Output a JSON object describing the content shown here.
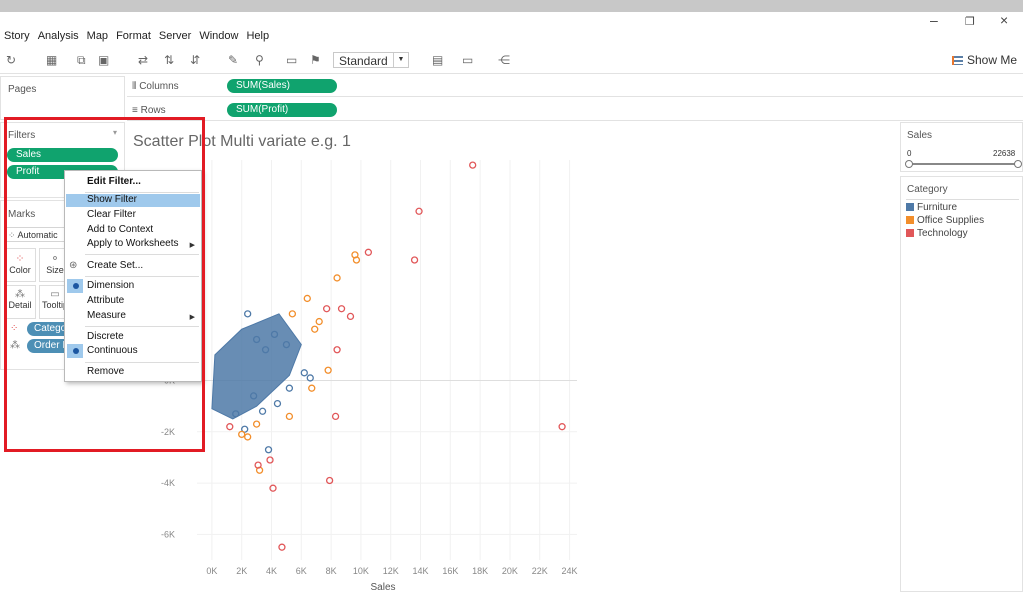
{
  "menubar": [
    "Story",
    "Analysis",
    "Map",
    "Format",
    "Server",
    "Window",
    "Help"
  ],
  "toolbar": {
    "mode": "Standard",
    "show_me": "Show Me"
  },
  "pages": {
    "title": "Pages"
  },
  "shelves": {
    "columns_label": "Columns",
    "columns_pill": "SUM(Sales)",
    "rows_label": "Rows",
    "rows_pill": "SUM(Profit)"
  },
  "filters": {
    "title": "Filters",
    "pills": [
      "Sales",
      "Profit"
    ]
  },
  "marks": {
    "title": "Marks",
    "type": "Automatic",
    "buttons": [
      "Color",
      "Size",
      "Detail",
      "Tooltip"
    ],
    "pills": [
      "Category",
      "Order ID"
    ]
  },
  "context_menu": {
    "items": [
      "Edit Filter...",
      "Show Filter",
      "Clear Filter",
      "Add to Context",
      "Apply to Worksheets",
      "Create Set...",
      "Dimension",
      "Attribute",
      "Measure",
      "Discrete",
      "Continuous",
      "Remove"
    ],
    "highlighted": "Show Filter",
    "checked": [
      "Dimension",
      "Continuous"
    ]
  },
  "sales_filter": {
    "title": "Sales",
    "min": "0",
    "max": "22638"
  },
  "legend": {
    "title": "Category",
    "items": [
      {
        "name": "Furniture",
        "color": "#4e79a7"
      },
      {
        "name": "Office Supplies",
        "color": "#f28e2b"
      },
      {
        "name": "Technology",
        "color": "#e15759"
      }
    ]
  },
  "chart_data": {
    "type": "scatter",
    "title": "Scatter Plot Multi variate e.g. 1",
    "xlabel": "Sales",
    "ylabel": "Profit",
    "x_ticks": [
      "0K",
      "2K",
      "4K",
      "6K",
      "8K",
      "10K",
      "12K",
      "14K",
      "16K",
      "18K",
      "20K",
      "22K",
      "24K"
    ],
    "y_ticks": [
      "0K",
      "-2K",
      "-4K",
      "-6K"
    ],
    "xlim": [
      -1000,
      24500
    ],
    "ylim": [
      -7000,
      8600
    ],
    "series": [
      {
        "name": "Furniture",
        "color": "#4e79a7",
        "points": [
          [
            2400,
            2600
          ],
          [
            3000,
            1600
          ],
          [
            3600,
            1200
          ],
          [
            4200,
            1800
          ],
          [
            5000,
            1400
          ],
          [
            6200,
            300
          ],
          [
            2800,
            -600
          ],
          [
            3400,
            -1200
          ],
          [
            4400,
            -900
          ],
          [
            1600,
            -1300
          ],
          [
            5200,
            -300
          ],
          [
            6600,
            100
          ],
          [
            3800,
            -2700
          ],
          [
            2200,
            -1900
          ]
        ]
      },
      {
        "name": "Office Supplies",
        "color": "#f28e2b",
        "points": [
          [
            9600,
            4900
          ],
          [
            9700,
            4700
          ],
          [
            8400,
            4000
          ],
          [
            6400,
            3200
          ],
          [
            5400,
            2600
          ],
          [
            7200,
            2300
          ],
          [
            6900,
            2000
          ],
          [
            7800,
            400
          ],
          [
            2400,
            -2200
          ],
          [
            3200,
            -3500
          ],
          [
            2000,
            -2100
          ],
          [
            5200,
            -1400
          ],
          [
            6700,
            -300
          ],
          [
            3000,
            -1700
          ]
        ]
      },
      {
        "name": "Technology",
        "color": "#e15759",
        "points": [
          [
            17500,
            8400
          ],
          [
            13900,
            6600
          ],
          [
            10500,
            5000
          ],
          [
            13600,
            4700
          ],
          [
            8700,
            2800
          ],
          [
            9300,
            2500
          ],
          [
            7700,
            2800
          ],
          [
            8400,
            1200
          ],
          [
            8300,
            -1400
          ],
          [
            23500,
            -1800
          ],
          [
            7900,
            -3900
          ],
          [
            4100,
            -4200
          ],
          [
            4700,
            -6500
          ],
          [
            3900,
            -3100
          ],
          [
            3100,
            -3300
          ],
          [
            1200,
            -1800
          ]
        ]
      }
    ]
  }
}
